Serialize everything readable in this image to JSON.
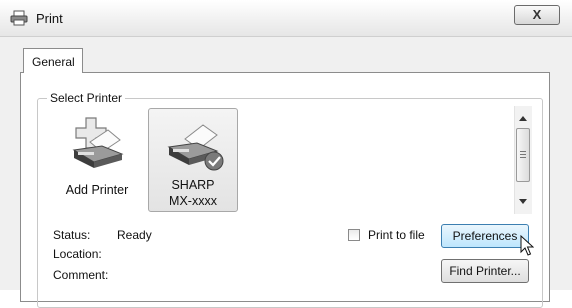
{
  "window": {
    "title": "Print",
    "close_symbol": "X"
  },
  "tabs": [
    {
      "label": "General"
    }
  ],
  "select_printer": {
    "group_label": "Select Printer",
    "printers": [
      {
        "label": "Add Printer",
        "icon": "add-printer-icon"
      },
      {
        "label": "SHARP\nMX-xxxx",
        "icon": "printer-default-icon",
        "selected": true
      }
    ]
  },
  "info": {
    "status_label": "Status:",
    "status_value": "Ready",
    "location_label": "Location:",
    "comment_label": "Comment:"
  },
  "options": {
    "print_to_file_label": "Print to file",
    "print_to_file_checked": false
  },
  "buttons": {
    "preferences": "Preferences",
    "find_printer": "Find Printer..."
  },
  "colors": {
    "window_bg": "#f0f0f0",
    "accent": "#3c7fb1"
  }
}
